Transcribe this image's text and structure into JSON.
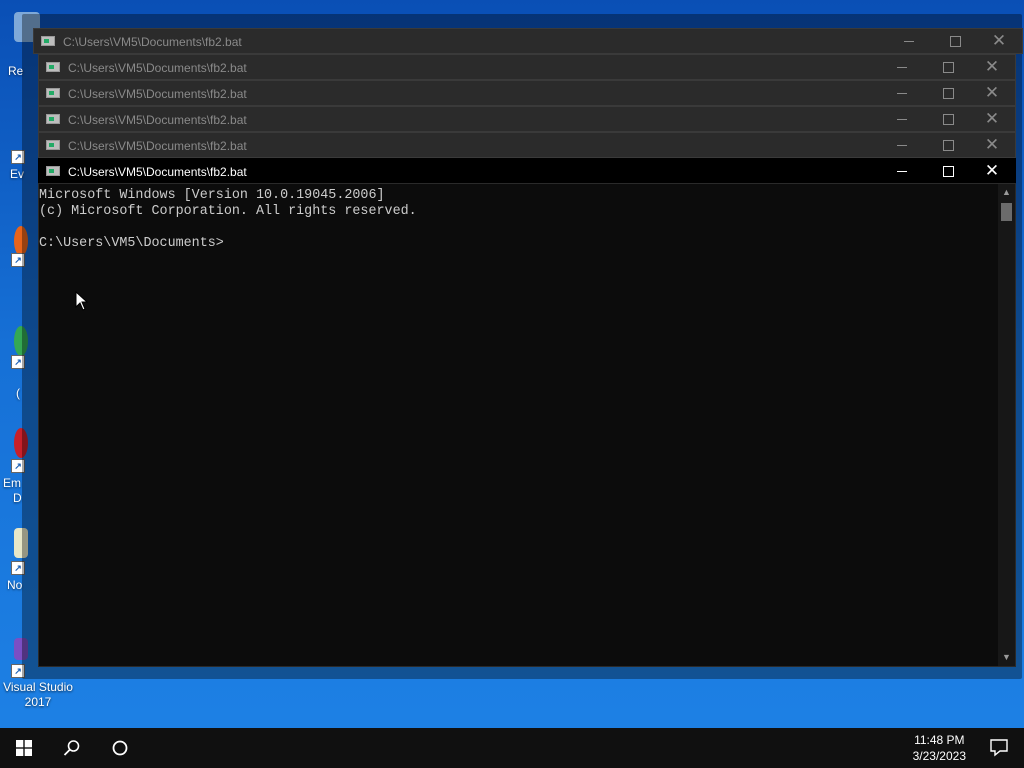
{
  "desktop": {
    "fragments": [
      "Re",
      "Ev",
      "(",
      "Em",
      "D",
      "No"
    ],
    "vs_label": "Visual Studio 2017"
  },
  "windows": [
    {
      "title": "C:\\Users\\VM5\\Documents\\fb2.bat"
    },
    {
      "title": "C:\\Users\\VM5\\Documents\\fb2.bat"
    },
    {
      "title": "C:\\Users\\VM5\\Documents\\fb2.bat"
    },
    {
      "title": "C:\\Users\\VM5\\Documents\\fb2.bat"
    },
    {
      "title": "C:\\Users\\VM5\\Documents\\fb2.bat"
    },
    {
      "title": "C:\\Users\\VM5\\Documents\\fb2.bat"
    }
  ],
  "window_controls": {
    "minimize": "─",
    "close": "✕"
  },
  "console": {
    "line1": "Microsoft Windows [Version 10.0.19045.2006]",
    "line2": "(c) Microsoft Corporation. All rights reserved.",
    "line3": "",
    "line4": "C:\\Users\\VM5\\Documents>"
  },
  "taskbar": {
    "time": "11:48 PM",
    "date": "3/23/2023"
  },
  "colors": {
    "accent": "#0a4fb5",
    "console_bg": "#0c0c0c",
    "taskbar_bg": "#101010"
  }
}
